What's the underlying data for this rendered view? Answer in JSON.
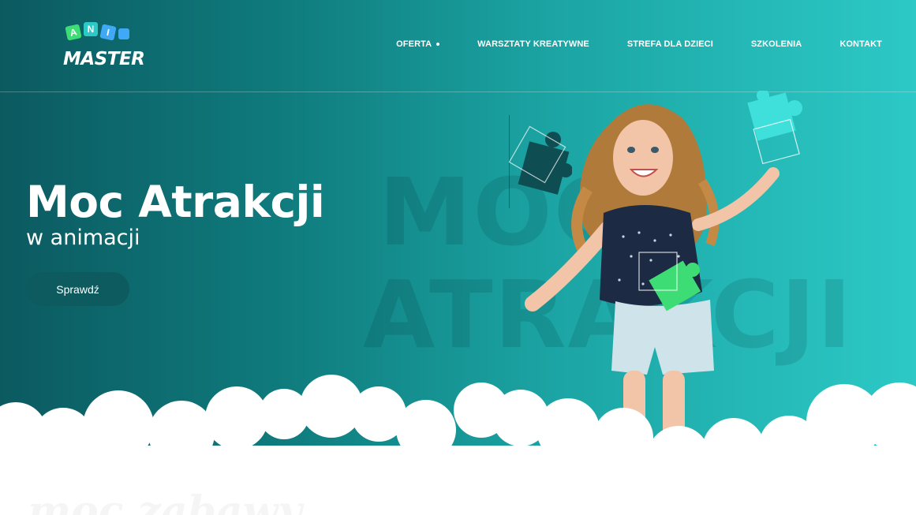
{
  "logo": {
    "tiles": [
      "A",
      "N",
      "I"
    ],
    "word": "MASTER"
  },
  "nav": [
    {
      "label": "OFERTA",
      "has_dropdown": true
    },
    {
      "label": "WARSZTATY KREATYWNE"
    },
    {
      "label": "STREFA DLA DZIECI"
    },
    {
      "label": "SZKOLENIA"
    },
    {
      "label": "KONTAKT"
    }
  ],
  "hero": {
    "title": "Moc Atrakcji",
    "subtitle": "w animacji",
    "button": "Sprawdź",
    "bg_word_1": "MOC",
    "bg_word_2": "ATRAKCJI"
  },
  "below": {
    "script_text": "moc zabawy"
  },
  "colors": {
    "gradient_start": "#0b5a60",
    "gradient_end": "#2cc9c6",
    "button": "#0d5a5f",
    "puzzle_dark": "#0e4d52",
    "puzzle_cyan": "#3fe0dc",
    "puzzle_green": "#3ddc74"
  }
}
